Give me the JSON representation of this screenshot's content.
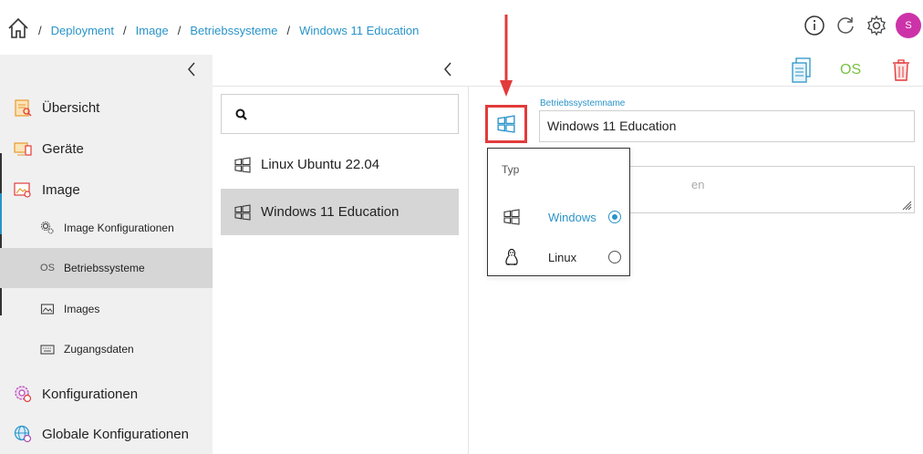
{
  "breadcrumb": [
    "Deployment",
    "Image",
    "Betriebssysteme",
    "Windows 11 Education"
  ],
  "header": {
    "avatar_initial": "S",
    "accent_color": "#2a94c9",
    "avatar_color": "#cc33a8"
  },
  "sidebar": {
    "items": [
      {
        "label": "Übersicht",
        "icon": "overview-icon"
      },
      {
        "label": "Geräte",
        "icon": "devices-icon"
      },
      {
        "label": "Image",
        "icon": "image-icon"
      },
      {
        "label": "Image Konfigurationen",
        "icon": "gears-icon",
        "sub": true
      },
      {
        "label": "Betriebssysteme",
        "icon": "os-text-icon",
        "icon_text": "OS",
        "sub": true,
        "active": true
      },
      {
        "label": "Images",
        "icon": "picture-icon",
        "sub": true
      },
      {
        "label": "Zugangsdaten",
        "icon": "keyboard-icon",
        "sub": true
      },
      {
        "label": "Konfigurationen",
        "icon": "config-icon"
      },
      {
        "label": "Globale Konfigurationen",
        "icon": "globe-config-icon"
      }
    ]
  },
  "toolbar": {
    "os_label": "OS",
    "os_color": "#78c241",
    "trash_color": "#e23b3b"
  },
  "list": {
    "items": [
      {
        "label": "Linux Ubuntu 22.04",
        "icon": "windows-icon"
      },
      {
        "label": "Windows 11 Education",
        "icon": "windows-icon",
        "selected": true
      }
    ]
  },
  "detail": {
    "name_label": "Betriebssystemname",
    "name_value": "Windows 11 Education",
    "description_placeholder_fragment": "en"
  },
  "dropdown": {
    "label": "Typ",
    "options": [
      {
        "label": "Windows",
        "selected": true,
        "icon": "windows-icon"
      },
      {
        "label": "Linux",
        "selected": false,
        "icon": "linux-tux-icon"
      }
    ]
  },
  "annotation": {
    "arrow_color": "#e23b3b"
  }
}
